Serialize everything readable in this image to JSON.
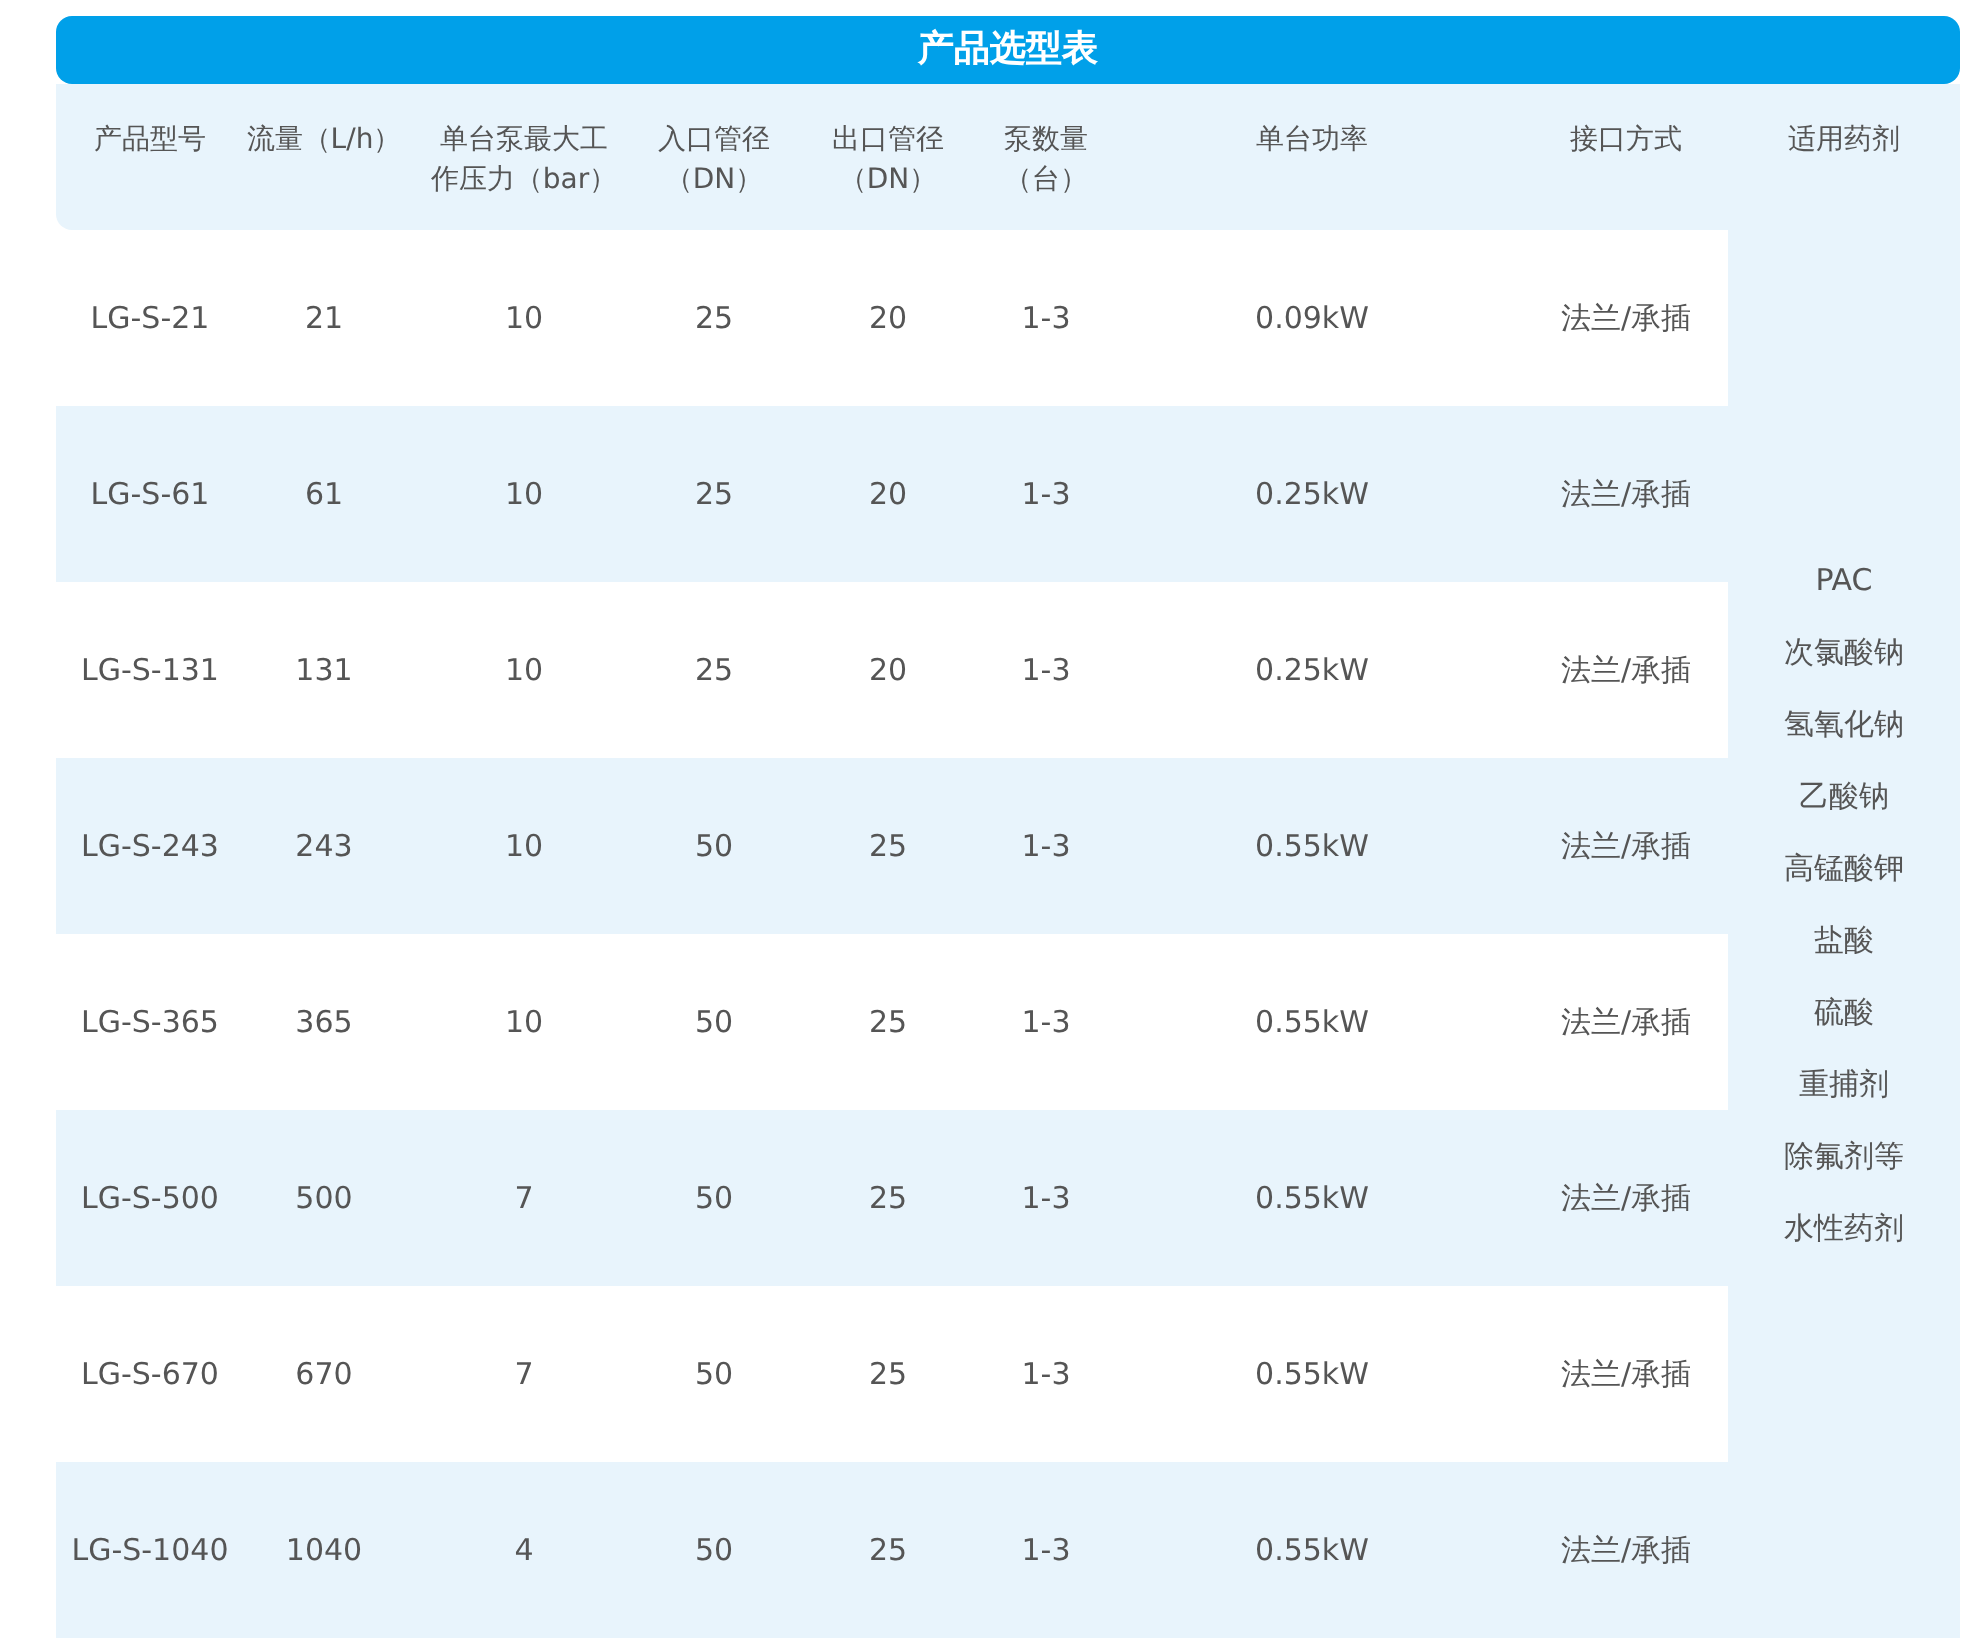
{
  "title": "产品选型表",
  "table": {
    "columns": [
      {
        "lines": [
          "产品型号"
        ]
      },
      {
        "lines": [
          "流量（L/h）"
        ]
      },
      {
        "lines": [
          "单台泵最大工",
          "作压力（bar）"
        ]
      },
      {
        "lines": [
          "入口管径",
          "（DN）"
        ]
      },
      {
        "lines": [
          "出口管径",
          "（DN）"
        ]
      },
      {
        "lines": [
          "泵数量",
          "（台）"
        ]
      },
      {
        "lines": [
          "单台功率"
        ]
      },
      {
        "lines": [
          "接口方式"
        ]
      },
      {
        "lines": [
          "适用药剂"
        ]
      }
    ],
    "rows": [
      [
        "LG-S-21",
        "21",
        "10",
        "25",
        "20",
        "1-3",
        "0.09kW",
        "法兰/承插"
      ],
      [
        "LG-S-61",
        "61",
        "10",
        "25",
        "20",
        "1-3",
        "0.25kW",
        "法兰/承插"
      ],
      [
        "LG-S-131",
        "131",
        "10",
        "25",
        "20",
        "1-3",
        "0.25kW",
        "法兰/承插"
      ],
      [
        "LG-S-243",
        "243",
        "10",
        "50",
        "25",
        "1-3",
        "0.55kW",
        "法兰/承插"
      ],
      [
        "LG-S-365",
        "365",
        "10",
        "50",
        "25",
        "1-3",
        "0.55kW",
        "法兰/承插"
      ],
      [
        "LG-S-500",
        "500",
        "7",
        "50",
        "25",
        "1-3",
        "0.55kW",
        "法兰/承插"
      ],
      [
        "LG-S-670",
        "670",
        "7",
        "50",
        "25",
        "1-3",
        "0.55kW",
        "法兰/承插"
      ],
      [
        "LG-S-1040",
        "1040",
        "4",
        "50",
        "25",
        "1-3",
        "0.55kW",
        "法兰/承插"
      ]
    ],
    "chemicals": [
      "PAC",
      "次氯酸钠",
      "氢氧化钠",
      "乙酸钠",
      "高锰酸钾",
      "盐酸",
      "硫酸",
      "重捕剂",
      "除氟剂等",
      "水性药剂"
    ]
  }
}
